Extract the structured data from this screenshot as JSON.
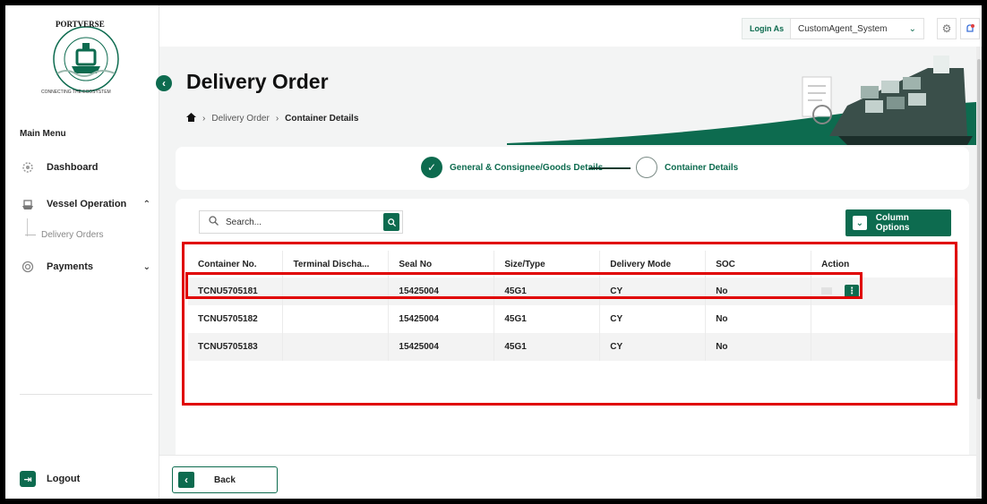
{
  "app": {
    "logo_text_top": "PORTVERSE",
    "logo_text_bottom": "CONNECTING THE ECOSYSTEM"
  },
  "sidebar": {
    "main_menu_label": "Main Menu",
    "items": [
      {
        "label": "Dashboard",
        "icon": "dashboard-icon"
      },
      {
        "label": "Vessel Operation",
        "icon": "vessel-icon",
        "expanded": true
      },
      {
        "label": "Payments",
        "icon": "payments-icon",
        "expanded": false
      }
    ],
    "submenu": {
      "label": "Delivery Orders"
    },
    "logout_label": "Logout"
  },
  "topbar": {
    "login_as_label": "Login As",
    "user_value": "CustomAgent_System"
  },
  "header": {
    "title": "Delivery Order",
    "breadcrumb": [
      "Delivery Order",
      "Container Details"
    ]
  },
  "stepper": {
    "steps": [
      {
        "label": "General & Consignee/Goods Details",
        "status": "done"
      },
      {
        "label": "Container Details",
        "status": "current"
      }
    ]
  },
  "table": {
    "search_placeholder": "Search...",
    "column_options_label": "Column Options",
    "columns": [
      "Container No.",
      "Terminal Discha...",
      "Seal No",
      "Size/Type",
      "Delivery Mode",
      "SOC",
      "Action"
    ],
    "rows": [
      {
        "container_no": "TCNU5705181",
        "terminal": "",
        "seal_no": "15425004",
        "size_type": "45G1",
        "delivery_mode": "CY",
        "soc": "No"
      },
      {
        "container_no": "TCNU5705182",
        "terminal": "",
        "seal_no": "15425004",
        "size_type": "45G1",
        "delivery_mode": "CY",
        "soc": "No"
      },
      {
        "container_no": "TCNU5705183",
        "terminal": "",
        "seal_no": "15425004",
        "size_type": "45G1",
        "delivery_mode": "CY",
        "soc": "No"
      }
    ],
    "action_glyph": "⋮"
  },
  "footer": {
    "back_label": "Back"
  },
  "colors": {
    "brand_green": "#0d6b4f",
    "highlight_red": "#e00000"
  }
}
